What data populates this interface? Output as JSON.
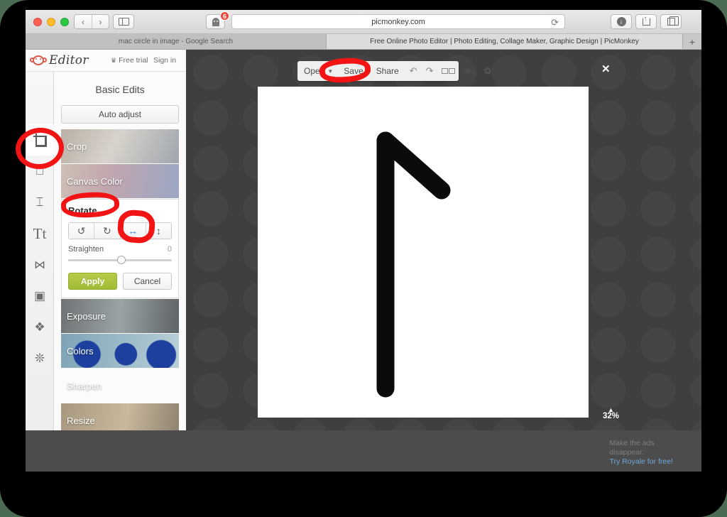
{
  "browser": {
    "url": "picmonkey.com",
    "back_icon": "chevron-left-icon",
    "forward_icon": "chevron-right-icon",
    "sidebar_icon": "sidebar-icon",
    "shield_icon": "ghostery-shield-icon",
    "shield_badge": "6",
    "reload_icon": "reload-icon",
    "download_icon": "download-icon",
    "share_icon": "share-icon",
    "tabs_icon": "show-all-tabs-icon",
    "new_tab_label": "+",
    "tabs": [
      {
        "title": "mac circle in image - Google Search",
        "active": false
      },
      {
        "title": "Free Online Photo Editor | Photo Editing, Collage Maker, Graphic Design | PicMonkey",
        "active": true
      }
    ]
  },
  "pm_header": {
    "logo_word": "Editor",
    "monkey_icon": "picmonkey-monkey-icon",
    "crown_icon": "crown-icon",
    "free_trial": "Free trial",
    "sign_in": "Sign in"
  },
  "rail": {
    "items": [
      {
        "name": "crop-tool",
        "icon": "crop-icon",
        "glyph": "",
        "active": true
      },
      {
        "name": "touch-up-tool",
        "icon": "magic-wand-icon",
        "glyph": "✨",
        "active": false
      },
      {
        "name": "retouch-tool",
        "icon": "lipstick-icon",
        "glyph": "▮",
        "active": false
      },
      {
        "name": "text-tool",
        "icon": "text-icon",
        "glyph": "Tt",
        "active": false
      },
      {
        "name": "overlays-tool",
        "icon": "butterfly-icon",
        "glyph": "🦋",
        "active": false
      },
      {
        "name": "frames-tool",
        "icon": "frame-icon",
        "glyph": "▢",
        "active": false
      },
      {
        "name": "textures-tool",
        "icon": "texture-icon",
        "glyph": "❖",
        "active": false
      },
      {
        "name": "seasonal-tool",
        "icon": "snowflake-icon",
        "glyph": "❊",
        "active": false
      }
    ]
  },
  "panel": {
    "title": "Basic Edits",
    "auto_adjust": "Auto adjust",
    "items_above": [
      {
        "label": "Crop",
        "c1": "#b9b0a6",
        "c2": "#d8d3cc",
        "c3": "#9fa6ad"
      },
      {
        "label": "Canvas Color",
        "c1": "#cdbfb4",
        "c2": "#c2a6ae",
        "c3": "#9aa7c4"
      }
    ],
    "items_below": [
      {
        "label": "Exposure",
        "c1": "#6f7374",
        "c2": "#9aa3a6",
        "c3": "#5e6365"
      },
      {
        "label": "Colors",
        "c1": "#6f9aae",
        "c2": "#2d4fa8",
        "c3": "#8fb6c6"
      },
      {
        "label": "Sharpen",
        "c1": "#8d9a6c",
        "c2": "#b7b07e",
        "c3": "#b05fa0"
      },
      {
        "label": "Resize",
        "c1": "#a89880",
        "c2": "#c4b49a",
        "c3": "#8e8270"
      }
    ]
  },
  "rotate": {
    "title": "Rotate",
    "buttons": [
      {
        "name": "rotate-left-button",
        "icon": "rotate-ccw-icon",
        "glyph": "↺",
        "highlight": false
      },
      {
        "name": "rotate-right-button",
        "icon": "rotate-cw-icon",
        "glyph": "↻",
        "highlight": false
      },
      {
        "name": "flip-horizontal-button",
        "icon": "flip-horizontal-icon",
        "glyph": "↔",
        "highlight": true
      },
      {
        "name": "flip-vertical-button",
        "icon": "flip-vertical-icon",
        "glyph": "↕",
        "highlight": false
      }
    ],
    "straighten_label": "Straighten",
    "straighten_value": "0",
    "apply": "Apply",
    "cancel": "Cancel"
  },
  "toolbar": {
    "open": "Open",
    "open_caret": "▼",
    "save": "Save",
    "share": "Share",
    "undo_icon": "undo-icon",
    "redo_icon": "redo-icon",
    "compare_icon": "compare-images-icon",
    "layers_icon": "layers-down-icon",
    "settings_icon": "gear-icon",
    "close_icon": "✕"
  },
  "canvas": {
    "zoom_caret": "▲",
    "zoom_percent": "32%",
    "drawing": "black-angle-stroke"
  },
  "ad": {
    "line1": "Make the ads",
    "line2": "disappear.",
    "link": "Try Royale for free!"
  },
  "annotations": {
    "marker_color": "#f21414",
    "circles": [
      "crop-tool",
      "save-button",
      "rotate-label",
      "flip-horizontal-button"
    ]
  }
}
